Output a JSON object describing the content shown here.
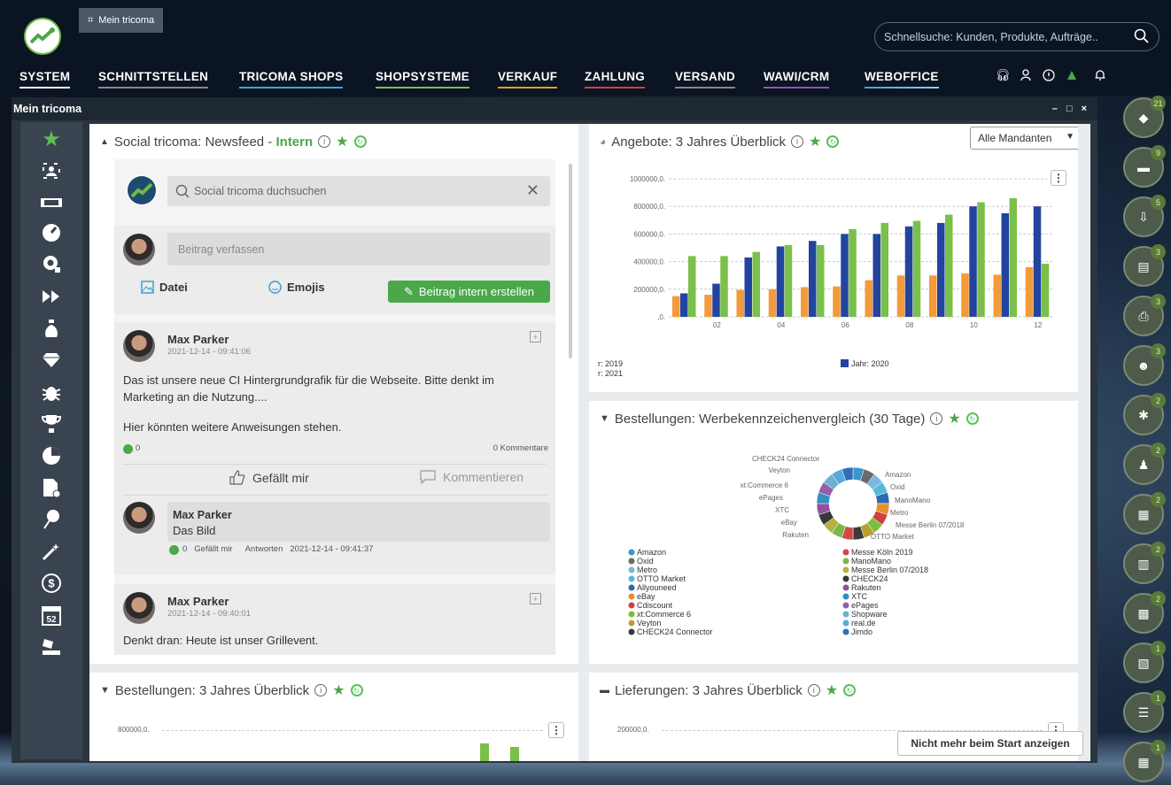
{
  "topbar": {
    "tab_label": "Mein tricoma",
    "search_placeholder": "Schnellsuche: Kunden, Produkte, Aufträge.."
  },
  "nav": {
    "items": [
      {
        "label": "SYSTEM",
        "color": "#ffffff"
      },
      {
        "label": "SCHNITTSTELLEN",
        "color": "#ffffff"
      },
      {
        "label": "TRICOMA SHOPS",
        "color": "#3aa8d8"
      },
      {
        "label": "SHOPSYSTEME",
        "color": "#7ac04a"
      },
      {
        "label": "VERKAUF",
        "color": "#e0a020"
      },
      {
        "label": "ZAHLUNG",
        "color": "#d04040"
      },
      {
        "label": "VERSAND",
        "color": "#ffffff"
      },
      {
        "label": "WAWI/CRM",
        "color": "#9050c0"
      },
      {
        "label": "WEBOFFICE",
        "color": "#40a0e0"
      }
    ]
  },
  "window": {
    "title": "Mein tricoma",
    "controls": [
      "–",
      "□",
      "×"
    ]
  },
  "newsfeed": {
    "title": "Social tricoma: Newsfeed - ",
    "title_tag": "Intern",
    "search_placeholder": "Social tricoma duchsuchen",
    "compose_placeholder": "Beitrag verfassen",
    "file_label": "Datei",
    "emoji_label": "Emojis",
    "post_button": "Beitrag intern erstellen",
    "posts": [
      {
        "author": "Max Parker",
        "date": "2021-12-14 - 09:41:06",
        "text1": "Das ist unsere neue CI Hintergrundgrafik für die Webseite. Bitte denkt im Marketing an die Nutzung....",
        "text2": "Hier könnten weitere Anweisungen stehen.",
        "likes": "0",
        "comments": "0 Kommentare",
        "like_action": "Gefällt mir",
        "comment_action": "Kommentieren",
        "reply": {
          "author": "Max Parker",
          "text": "Das Bild",
          "likes": "0",
          "like": "Gefällt mir",
          "answer": "Antworten",
          "date": "2021-12-14 - 09:41:37"
        }
      },
      {
        "author": "Max Parker",
        "date": "2021-12-14 - 09:40:01",
        "text1": "Denkt dran: Heute ist unser Grillevent."
      }
    ]
  },
  "angebote": {
    "title": "Angebote: 3 Jahres Überblick",
    "select_value": "Alle Mandanten",
    "legend": [
      "r: 2019",
      "r: 2021",
      "Jahr: 2020"
    ]
  },
  "bestellungen_werbe": {
    "title": "Bestellungen: Werbekennzeichenvergleich (30 Tage)"
  },
  "bestellungen_3": {
    "title": "Bestellungen: 3 Jahres Überblick",
    "tick": "800000,0."
  },
  "lieferungen": {
    "title": "Lieferungen: 3 Jahres Überblick",
    "tick": "200000,0."
  },
  "footer": {
    "dont_show": "Nicht mehr beim Start anzeigen"
  },
  "rightbar": {
    "badges": [
      "21",
      "9",
      "5",
      "3",
      "3",
      "3",
      "2",
      "2",
      "2",
      "2",
      "2",
      "1",
      "1",
      "1"
    ]
  },
  "chart_data": [
    {
      "type": "bar",
      "title": "Angebote: 3 Jahres Überblick",
      "categories": [
        "01",
        "02",
        "03",
        "04",
        "05",
        "06",
        "07",
        "08",
        "09",
        "10",
        "11",
        "12"
      ],
      "tick_labels": [
        "02",
        "04",
        "06",
        "08",
        "10",
        "12"
      ],
      "ytick_labels": [
        "1000000,0.",
        "800000,0.",
        "600000,0.",
        "400000,0.",
        "200000,0.",
        ",0."
      ],
      "ylim": [
        0,
        1000000
      ],
      "series": [
        {
          "name": "r: 2019",
          "color": "#f39a3a",
          "values": [
            150000,
            160000,
            195000,
            200000,
            215000,
            220000,
            265000,
            300000,
            300000,
            315000,
            305000,
            360000
          ]
        },
        {
          "name": "Jahr: 2020",
          "color": "#2244a0",
          "values": [
            170000,
            240000,
            430000,
            510000,
            550000,
            600000,
            600000,
            655000,
            680000,
            800000,
            750000,
            800000
          ]
        },
        {
          "name": "r: 2021",
          "color": "#7ac04a",
          "values": [
            440000,
            440000,
            470000,
            520000,
            520000,
            635000,
            680000,
            695000,
            740000,
            830000,
            860000,
            385000
          ]
        }
      ],
      "grid": true
    },
    {
      "type": "pie",
      "title": "Bestellungen: Werbekennzeichenvergleich (30 Tage)",
      "categories": [
        "Amazon",
        "Oxid",
        "Metro",
        "OTTO Market",
        "Allyouneed",
        "eBay",
        "Cdiscount",
        "xt:Commerce 6",
        "Veyton",
        "CHECK24 Connector",
        "Messe Köln 2019",
        "ManoMano",
        "Messe Berlin 07/2018",
        "CHECK24",
        "Rakuten",
        "XTC",
        "ePages",
        "Shopware",
        "real.de",
        "Jimdo"
      ],
      "colors": [
        "#3a98c8",
        "#6a6a6a",
        "#7ab8e0",
        "#58b8d8",
        "#2a6ab0",
        "#e89030",
        "#d04040",
        "#7ac040",
        "#b8a030",
        "#3a3a3a",
        "#d04848",
        "#7ab848",
        "#b8b040",
        "#383838",
        "#9050a0",
        "#3090c0",
        "#9060a8",
        "#70b0d0",
        "#58a8e0",
        "#3070b8"
      ],
      "values": [
        1,
        1,
        1,
        1,
        1,
        1,
        1,
        1,
        1,
        1,
        1,
        1,
        1,
        1,
        1,
        1,
        1,
        1,
        1,
        1
      ],
      "callouts": [
        "CHECK24 Connector",
        "Veyton",
        "xt:Commerce 6",
        "ePages",
        "XTC",
        "eBay",
        "Rakuten",
        "Amazon",
        "Oxid",
        "ManoMano",
        "Metro",
        "Messe Berlin 07/2018",
        "OTTO Market"
      ]
    }
  ]
}
